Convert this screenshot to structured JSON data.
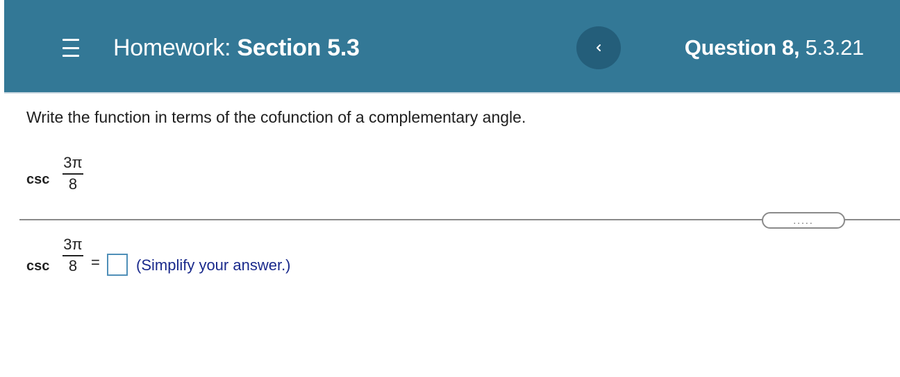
{
  "header": {
    "title_prefix": "Homework:",
    "title_section": "Section 5.3",
    "question_label": "Question 8,",
    "question_number": "5.3.21"
  },
  "question": {
    "instruction": "Write the function in terms of the cofunction of a complementary angle.",
    "given": {
      "function": "csc",
      "numerator": "3π",
      "denominator": "8"
    }
  },
  "more_button": {
    "label": "....."
  },
  "answer": {
    "function": "csc",
    "numerator": "3π",
    "denominator": "8",
    "equals": "=",
    "value": "",
    "hint": "(Simplify your answer.)"
  },
  "colors": {
    "header_bg": "#337896",
    "nav_button_bg": "#245e7a",
    "hint_text": "#1a2a8c",
    "answer_box_border": "#4f8fb8"
  },
  "icons": {
    "menu": "hamburger-menu-icon",
    "previous": "chevron-left-icon"
  }
}
